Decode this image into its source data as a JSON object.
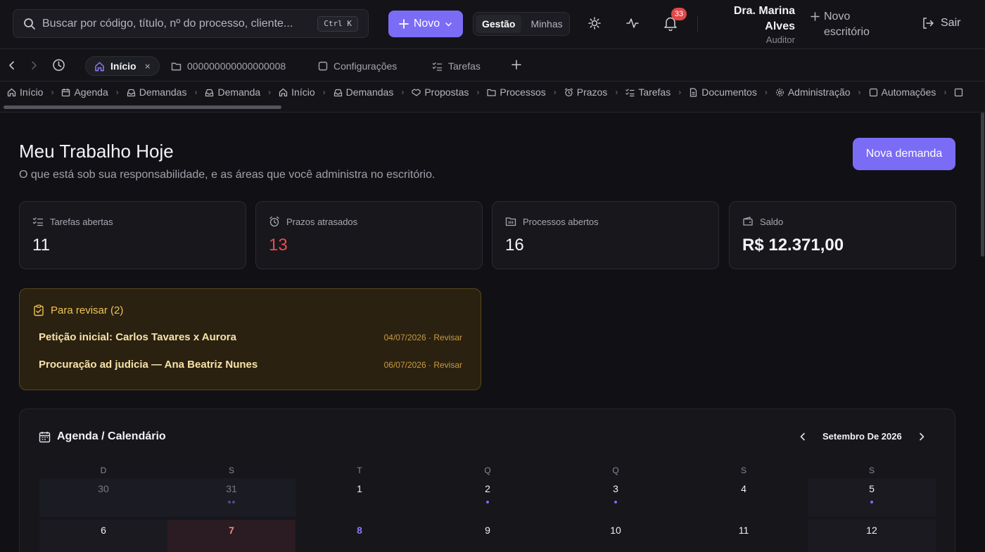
{
  "topbar": {
    "search_placeholder": "Buscar por código, título, nº do processo, cliente...",
    "search_shortcut": "Ctrl K",
    "new_button": "Novo",
    "view_toggle": {
      "active": "Gestão",
      "inactive": "Minhas"
    },
    "notification_count": "33",
    "user": {
      "name_line1": "Dra. Marina",
      "name_line2": "Alves",
      "role": "Auditor"
    },
    "new_office": "Novo escritório",
    "logout": "Sair"
  },
  "tabs": [
    {
      "label": "Início",
      "icon": "home-icon"
    },
    {
      "label": "000000000000000008",
      "icon": "folder-icon"
    },
    {
      "label": "Configurações",
      "icon": "square-icon"
    },
    {
      "label": "Tarefas",
      "icon": "list-check-icon"
    }
  ],
  "breadcrumb": [
    "Início",
    "Agenda",
    "Demandas",
    "Demanda",
    "Início",
    "Demandas",
    "Propostas",
    "Processos",
    "Prazos",
    "Tarefas",
    "Documentos",
    "Administração",
    "Automações"
  ],
  "page": {
    "title": "Meu Trabalho Hoje",
    "subtitle": "O que está sob sua responsabilidade, e as áreas que você administra no escritório.",
    "new_demand_button": "Nova demanda"
  },
  "stats": [
    {
      "label": "Tarefas abertas",
      "value": "11",
      "icon": "list-check-icon"
    },
    {
      "label": "Prazos atrasados",
      "value": "13",
      "icon": "alarm-icon",
      "color": "#ee4a4a"
    },
    {
      "label": "Processos abertos",
      "value": "16",
      "icon": "folder-icon"
    },
    {
      "label": "Saldo",
      "value": "R$ 12.371,00",
      "icon": "wallet-icon"
    }
  ],
  "review": {
    "title": "Para revisar (2)",
    "items": [
      {
        "title": "Petição inicial: Carlos Tavares x Aurora",
        "meta": "04/07/2026 · Revisar"
      },
      {
        "title": "Procuração ad judicia — Ana Beatriz Nunes",
        "meta": "06/07/2026 · Revisar"
      }
    ]
  },
  "calendar": {
    "title": "Agenda / Calendário",
    "month": "Setembro De 2026",
    "weekdays": [
      "D",
      "S",
      "T",
      "Q",
      "Q",
      "S",
      "S"
    ],
    "weeks": [
      [
        "30",
        "31",
        "1",
        "2",
        "3",
        "4",
        "5"
      ],
      [
        "6",
        "7",
        "8",
        "9",
        "10",
        "11",
        "12"
      ]
    ]
  },
  "colors": {
    "accent": "#7b6cf6",
    "danger": "#ee4a4a",
    "warning": "#f0c454"
  }
}
